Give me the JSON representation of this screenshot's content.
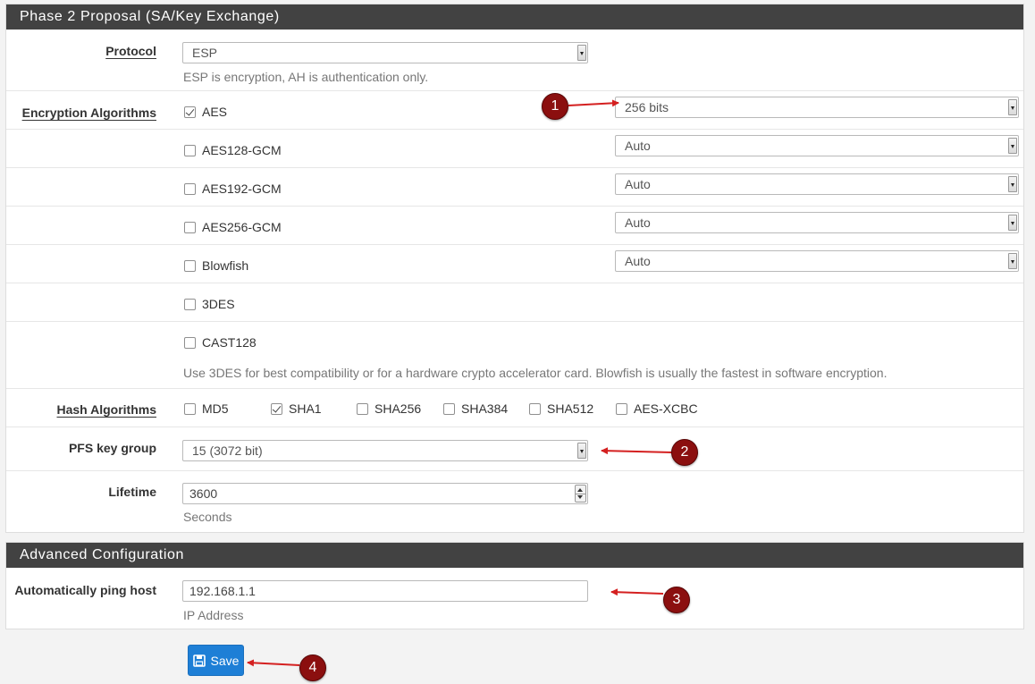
{
  "phase2": {
    "title": "Phase 2 Proposal (SA/Key Exchange)",
    "protocol": {
      "label": "Protocol",
      "value": "ESP",
      "help": "ESP is encryption, AH is authentication only."
    },
    "encryption": {
      "label": "Encryption Algorithms",
      "items": [
        {
          "name": "AES",
          "checked": true,
          "keylen": "256 bits"
        },
        {
          "name": "AES128-GCM",
          "checked": false,
          "keylen": "Auto"
        },
        {
          "name": "AES192-GCM",
          "checked": false,
          "keylen": "Auto"
        },
        {
          "name": "AES256-GCM",
          "checked": false,
          "keylen": "Auto"
        },
        {
          "name": "Blowfish",
          "checked": false,
          "keylen": "Auto"
        },
        {
          "name": "3DES",
          "checked": false
        },
        {
          "name": "CAST128",
          "checked": false
        }
      ],
      "help": "Use 3DES for best compatibility or for a hardware crypto accelerator card. Blowfish is usually the fastest in software encryption."
    },
    "hash": {
      "label": "Hash Algorithms",
      "items": [
        {
          "name": "MD5",
          "checked": false
        },
        {
          "name": "SHA1",
          "checked": true
        },
        {
          "name": "SHA256",
          "checked": false
        },
        {
          "name": "SHA384",
          "checked": false
        },
        {
          "name": "SHA512",
          "checked": false
        },
        {
          "name": "AES-XCBC",
          "checked": false
        }
      ]
    },
    "pfs": {
      "label": "PFS key group",
      "value": "15 (3072 bit)"
    },
    "lifetime": {
      "label": "Lifetime",
      "value": "3600",
      "help": "Seconds"
    }
  },
  "advanced": {
    "title": "Advanced Configuration",
    "ping": {
      "label": "Automatically ping host",
      "value": "192.168.1.1",
      "help": "IP Address"
    }
  },
  "save_label": "Save",
  "annotations": [
    "1",
    "2",
    "3",
    "4"
  ],
  "colors": {
    "heading_bg": "#424242",
    "save_button": "#1e7fd6",
    "annotation_badge": "#8b0f0f",
    "annotation_arrow": "#d42020"
  }
}
